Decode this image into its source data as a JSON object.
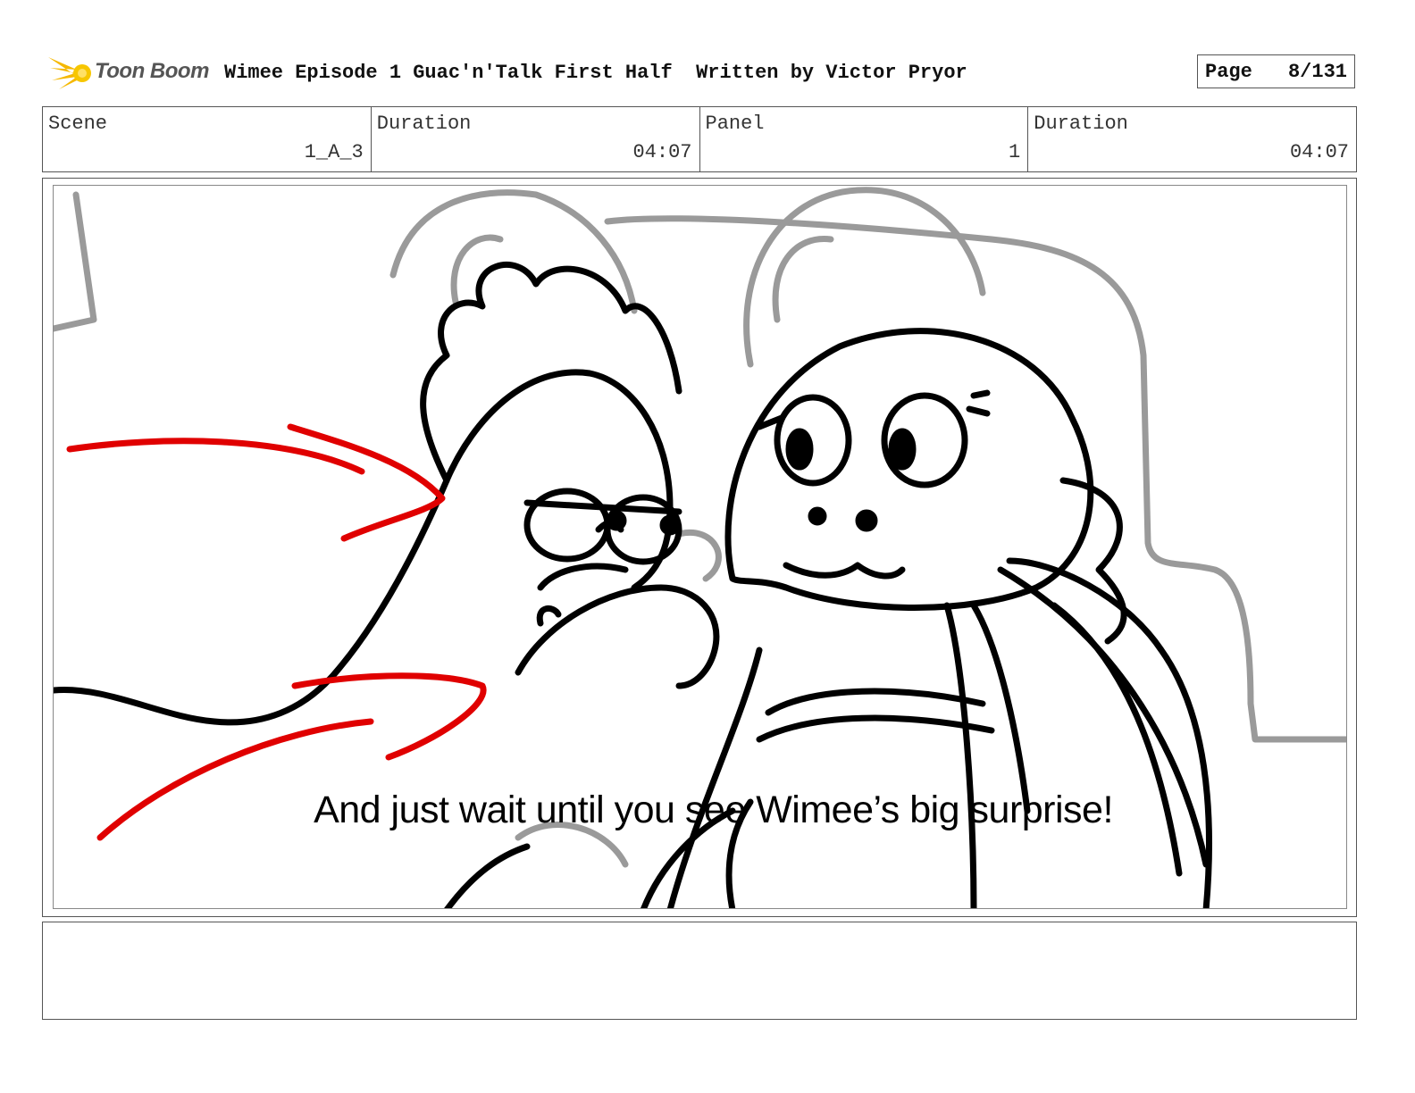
{
  "header": {
    "logo_text": "Toon Boom",
    "title": "Wimee Episode 1 Guac'n'Talk First Half  Written by Victor Pryor",
    "page_label": "Page",
    "page_value": "8/131"
  },
  "info": {
    "scene_label": "Scene",
    "scene_value": "1_A_3",
    "duration_label": "Duration",
    "duration_value": "04:07",
    "panel_label": "Panel",
    "panel_value": "1",
    "panel_duration_label": "Duration",
    "panel_duration_value": "04:07"
  },
  "panel": {
    "caption": "And just wait until you see Wimee’s big surprise!"
  },
  "colors": {
    "motion_lines": "#e00000",
    "background_sketch": "#999999",
    "ink": "#000000"
  }
}
